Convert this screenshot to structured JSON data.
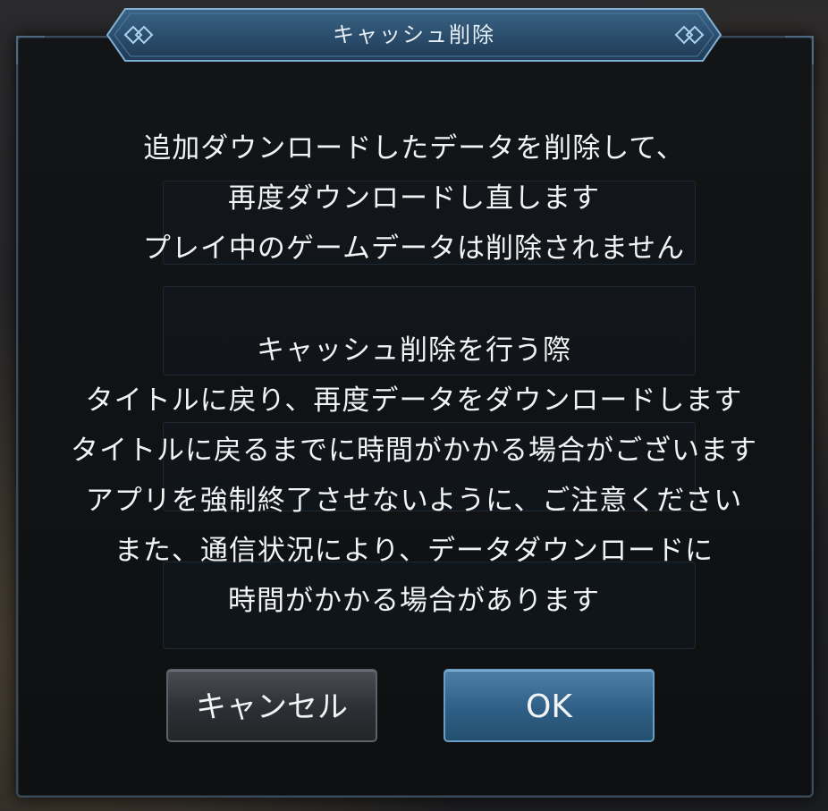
{
  "dialog": {
    "title": "キャッシュ削除",
    "message_lines": [
      "追加ダウンロードしたデータを削除して、",
      "再度ダウンロードし直します",
      "プレイ中のゲームデータは削除されません",
      "",
      "キャッシュ削除を行う際",
      "タイトルに戻り、再度データをダウンロードします",
      "タイトルに戻るまでに時間がかかる場合がございます",
      "アプリを強制終了させないように、ご注意ください",
      "また、通信状況により、データダウンロードに",
      "時間がかかる場合があります"
    ],
    "cancel_label": "キャンセル",
    "ok_label": "OK"
  },
  "colors": {
    "banner_fill": "#2c4f6e",
    "banner_border": "#7fb0d6",
    "ok_button": "#2f5f86",
    "cancel_button": "#2c2f33"
  },
  "icons": [
    "diamond-ornament-icon"
  ]
}
